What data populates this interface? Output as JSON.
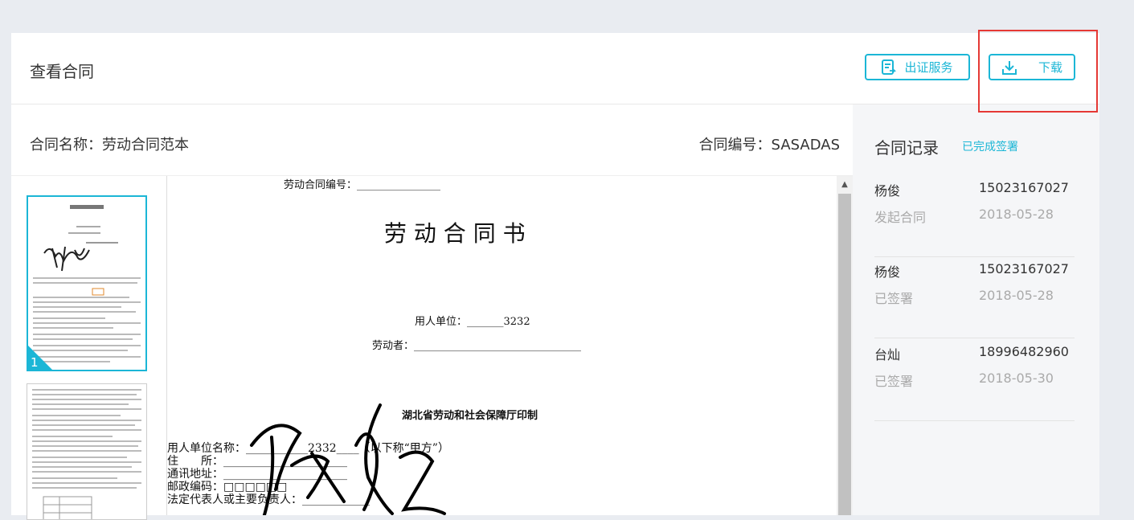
{
  "header": {
    "title": "查看合同",
    "cert_button": "出证服务",
    "download_button": "下载"
  },
  "contract": {
    "name_label": "合同名称：劳动合同范本",
    "number_label": "合同编号：SASADAS"
  },
  "thumbnails": {
    "page1_number": "1"
  },
  "document": {
    "number_line": "劳动合同编号：________________",
    "heading": "劳 动 合 同 书",
    "employer_line": "用人单位：_______3232",
    "worker_line": "劳动者：________________________________",
    "printer_line": "湖北省劳动和社会保障厅印制",
    "field_employer": "用人单位名称：___________2332____（以下称“甲方”）",
    "field_address": "住　　所：______________________",
    "field_contact": "通讯地址：______________________",
    "field_postal": "邮政编码：□□□□□□",
    "field_legal": "法定代表人或主要负责人：____________"
  },
  "signature": {
    "text": "杨俊"
  },
  "sidebar": {
    "title": "合同记录",
    "status": "已完成签署",
    "records": [
      {
        "name": "杨俊",
        "phone": "15023167027",
        "action": "发起合同",
        "date": "2018-05-28"
      },
      {
        "name": "杨俊",
        "phone": "15023167027",
        "action": "已签署",
        "date": "2018-05-28"
      },
      {
        "name": "台灿",
        "phone": "18996482960",
        "action": "已签署",
        "date": "2018-05-30"
      }
    ]
  },
  "colors": {
    "accent": "#1bb6d6",
    "highlight": "#e53935",
    "background": "#e9ecf1"
  }
}
